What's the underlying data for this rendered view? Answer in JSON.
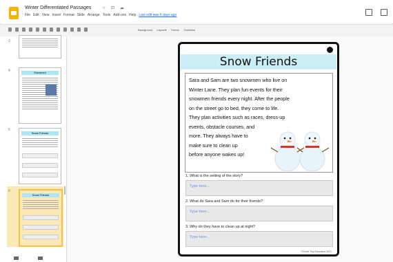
{
  "app": {
    "doc_title": "Winter Differentiated Passages",
    "title_icons": "☆ ⊡ ☁",
    "menu": [
      "File",
      "Edit",
      "View",
      "Insert",
      "Format",
      "Slide",
      "Arrange",
      "Tools",
      "Add-ons",
      "Help"
    ],
    "last_edit": "Last edit was 6 days ago"
  },
  "toolbar": {
    "labels": [
      "Background",
      "Layout▾",
      "Theme",
      "Transition"
    ]
  },
  "filmstrip": {
    "numbers": [
      "3",
      "4",
      "5",
      "6"
    ],
    "thumbs": [
      {
        "title": ""
      },
      {
        "title": "Snowmen"
      },
      {
        "title": "Snow Friends"
      },
      {
        "title": "Snow Friends"
      }
    ]
  },
  "slide": {
    "title": "Snow Friends",
    "story_lines": [
      "Sara and Sam are two snowmen who live on",
      "Winter Lane. They plan fun events for their",
      "snowmen friends every night. After the people",
      "on the street go to bed, they come to life.",
      "They plan activities such as races, dress-up",
      "events, obstacle courses, and",
      "more. They always have to",
      "make sure to clean up",
      "before anyone wakes up!"
    ],
    "questions": [
      {
        "label": "1. What is the setting of the story?",
        "placeholder": "Type here..."
      },
      {
        "label": "2. What do Sara and Sam do for their friends?",
        "placeholder": "Type here..."
      },
      {
        "label": "3. Why do they have to clean up at night?",
        "placeholder": "Type here..."
      }
    ],
    "copyright": "©Some Tiny Education 2021"
  },
  "colors": {
    "title_band": "#c9eef4",
    "selected_thumb": "#fde9b8",
    "link_blue": "#1a73e8"
  }
}
